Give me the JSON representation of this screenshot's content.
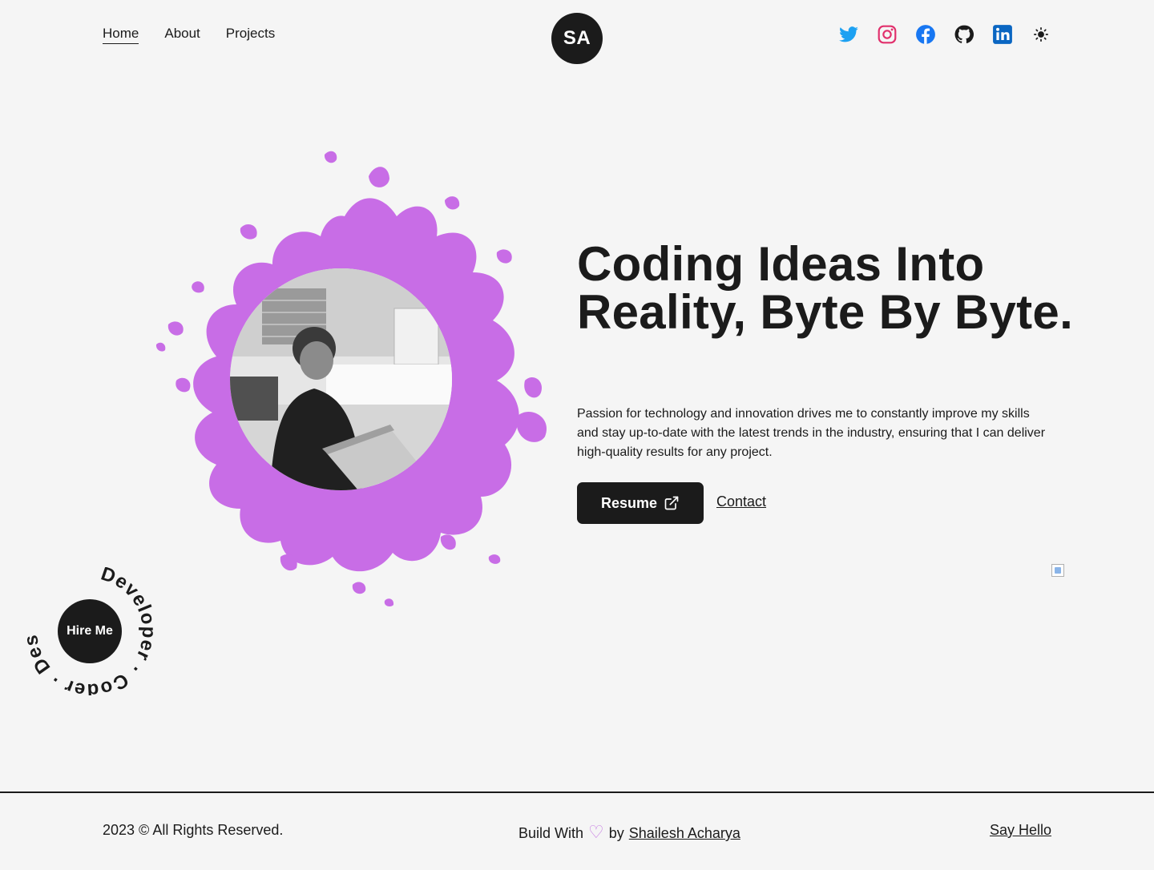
{
  "header": {
    "nav": [
      {
        "label": "Home",
        "active": true
      },
      {
        "label": "About",
        "active": false
      },
      {
        "label": "Projects",
        "active": false
      }
    ],
    "logo": "SA",
    "social_icons": [
      "twitter-icon",
      "instagram-icon",
      "facebook-icon",
      "github-icon",
      "linkedin-icon",
      "sun-icon"
    ]
  },
  "hero": {
    "title": "Coding Ideas Into Reality, Byte By Byte.",
    "description": "Passion for technology and innovation drives me to constantly improve my skills and stay up-to-date with the latest trends in the industry, ensuring that I can deliver high-quality results for any project.",
    "resume_label": "Resume",
    "contact_label": "Contact"
  },
  "hire_badge": {
    "label": "Hire Me",
    "ring_text": "Developer · Coder · Designer ·"
  },
  "footer": {
    "copyright": "2023 © All Rights Reserved.",
    "built_prefix": "Build With",
    "heart": "♡",
    "built_by": "by",
    "author": "Shailesh Acharya",
    "say_hello": "Say Hello"
  },
  "colors": {
    "text": "#1b1b1b",
    "background": "#f5f5f5",
    "accent": "#c86de6",
    "twitter": "#1da1f2",
    "instagram": "#e1306c",
    "facebook": "#1877f2",
    "linkedin": "#0a66c2"
  }
}
